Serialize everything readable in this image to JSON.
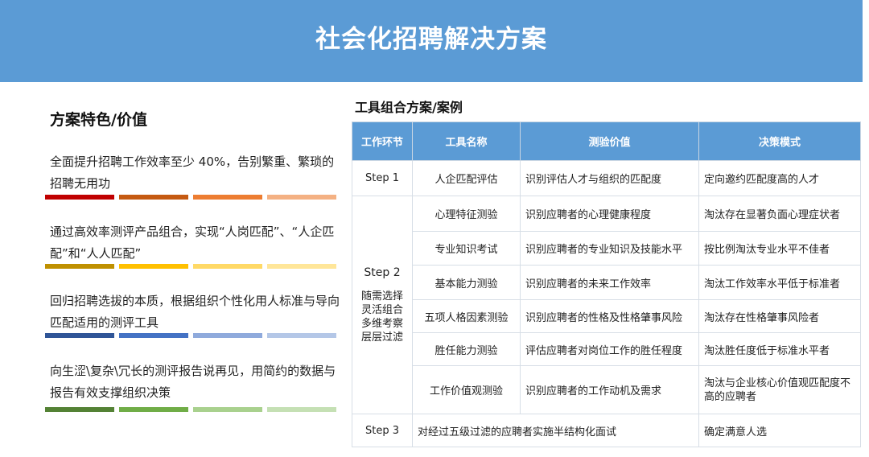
{
  "banner": {
    "title": "社会化招聘解决方案"
  },
  "features": {
    "heading": "方案特色/价值",
    "items": [
      {
        "text": "全面提升招聘工作效率至少 40%，告别繁重、繁琐的招聘无用功",
        "colors": [
          "#c00000",
          "#c55a11",
          "#ed7d31",
          "#f4b183"
        ]
      },
      {
        "text": "通过高效率测评产品组合，实现“人岗匹配”、“人企匹配”和“人人匹配”",
        "colors": [
          "#bf9000",
          "#ffc000",
          "#ffd966",
          "#ffe699"
        ]
      },
      {
        "text": "回归招聘选拔的本质，根据组织个性化用人标准与导向匹配适用的测评工具",
        "colors": [
          "#2f5597",
          "#4472c4",
          "#8faadc",
          "#b4c7e7"
        ]
      },
      {
        "text": "向生涩\\复杂\\冗长的测评报告说再见，用简约的数据与报告有效支撑组织决策",
        "colors": [
          "#548235",
          "#70ad47",
          "#a9d18e",
          "#c5e0b4"
        ]
      }
    ]
  },
  "tools": {
    "title": "工具组合方案/案例",
    "headers": [
      "工作环节",
      "工具名称",
      "测验价值",
      "决策模式"
    ],
    "step1": {
      "step": "Step 1",
      "tool": "人企匹配评估",
      "value": "识别评估人才与组织的匹配度",
      "decision": "定向邀约匹配度高的人才"
    },
    "step2": {
      "step": "Step 2",
      "note": [
        "随需选择",
        "灵活组合",
        "多维考察",
        "层层过滤"
      ],
      "rows": [
        {
          "tool": "心理特征测验",
          "value": "识别应聘者的心理健康程度",
          "decision": "淘汰存在显著负面心理症状者"
        },
        {
          "tool": "专业知识考试",
          "value": "识别应聘者的专业知识及技能水平",
          "decision": "按比例淘汰专业水平不佳者"
        },
        {
          "tool": "基本能力测验",
          "value": "识别应聘者的未来工作效率",
          "decision": "淘汰工作效率水平低于标准者"
        },
        {
          "tool": "五项人格因素测验",
          "value": "识别应聘者的性格及性格肇事风险",
          "decision": "淘汰存在性格肇事风险者"
        },
        {
          "tool": "胜任能力测验",
          "value": "评估应聘者对岗位工作的胜任程度",
          "decision": "淘汰胜任度低于标准水平者"
        },
        {
          "tool": "工作价值观测验",
          "value": "识别应聘者的工作动机及需求",
          "decision": "淘汰与企业核心价值观匹配度不高的应聘者"
        }
      ]
    },
    "step3": {
      "step": "Step 3",
      "desc": "对经过五级过滤的应聘者实施半结构化面试",
      "decision": "确定满意人选"
    }
  }
}
